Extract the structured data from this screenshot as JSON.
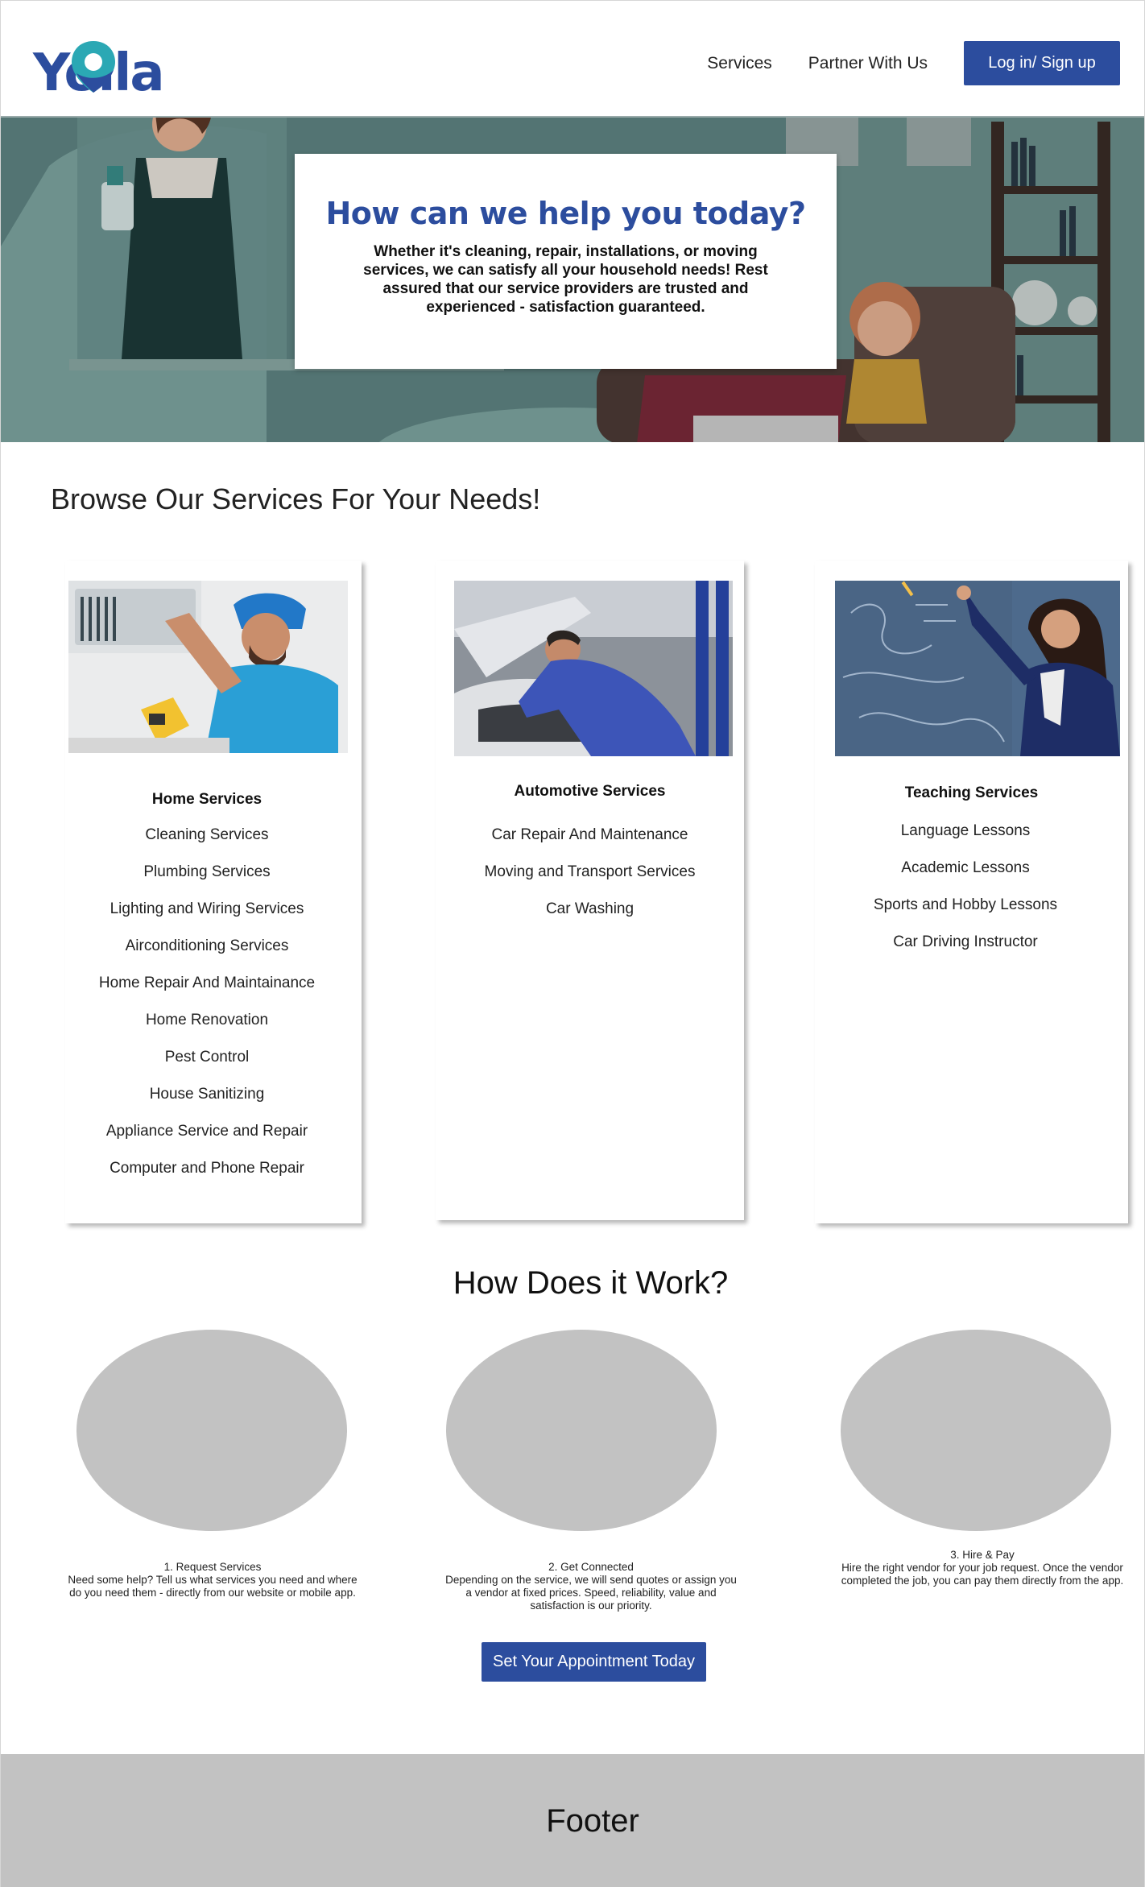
{
  "header": {
    "logo_text": "Yolla",
    "nav": [
      "Services",
      "Partner With Us"
    ],
    "login_label": "Log in/ Sign up"
  },
  "hero": {
    "title": "How can we help you today?",
    "subtitle": "Whether it's cleaning, repair, installations, or moving services, we can satisfy all your household needs! Rest assured that our service providers are trusted and experienced - satisfaction guaranteed."
  },
  "browse": {
    "title": "Browse Our Services For Your Needs!",
    "cards": [
      {
        "heading": "Home Services",
        "items": [
          "Cleaning Services",
          "Plumbing Services",
          "Lighting and Wiring Services",
          "Airconditioning Services",
          "Home Repair And Maintainance",
          "Home Renovation",
          "Pest Control",
          "House Sanitizing",
          "Appliance Service and Repair",
          "Computer and Phone Repair"
        ]
      },
      {
        "heading": "Automotive Services",
        "items": [
          "Car Repair And Maintenance",
          "Moving and Transport Services",
          "Car Washing"
        ]
      },
      {
        "heading": "Teaching Services",
        "items": [
          "Language Lessons",
          "Academic Lessons",
          "Sports and Hobby Lessons",
          "Car Driving Instructor"
        ]
      }
    ]
  },
  "how": {
    "title": "How Does it Work?",
    "steps": [
      {
        "title": "1. Request Services",
        "text": "Need some help? Tell us what services you need and where do you need them - directly from our website or mobile app."
      },
      {
        "title": "2. Get Connected",
        "text": "Depending on the service, we will send quotes or assign you a vendor at fixed prices. Speed, reliability, value and satisfaction is our priority."
      },
      {
        "title": "3. Hire & Pay",
        "text": "Hire the right vendor for your job request. Once the vendor completed the job, you can pay them directly from the app."
      }
    ],
    "cta_label": "Set Your Appointment Today"
  },
  "footer": {
    "label": "Footer"
  },
  "colors": {
    "brand": "#2c4d9e",
    "placeholder": "#c2c2c2",
    "hero_teal": "#6f8f8c"
  },
  "icons": {
    "logo_pin": "location-pin-icon"
  }
}
